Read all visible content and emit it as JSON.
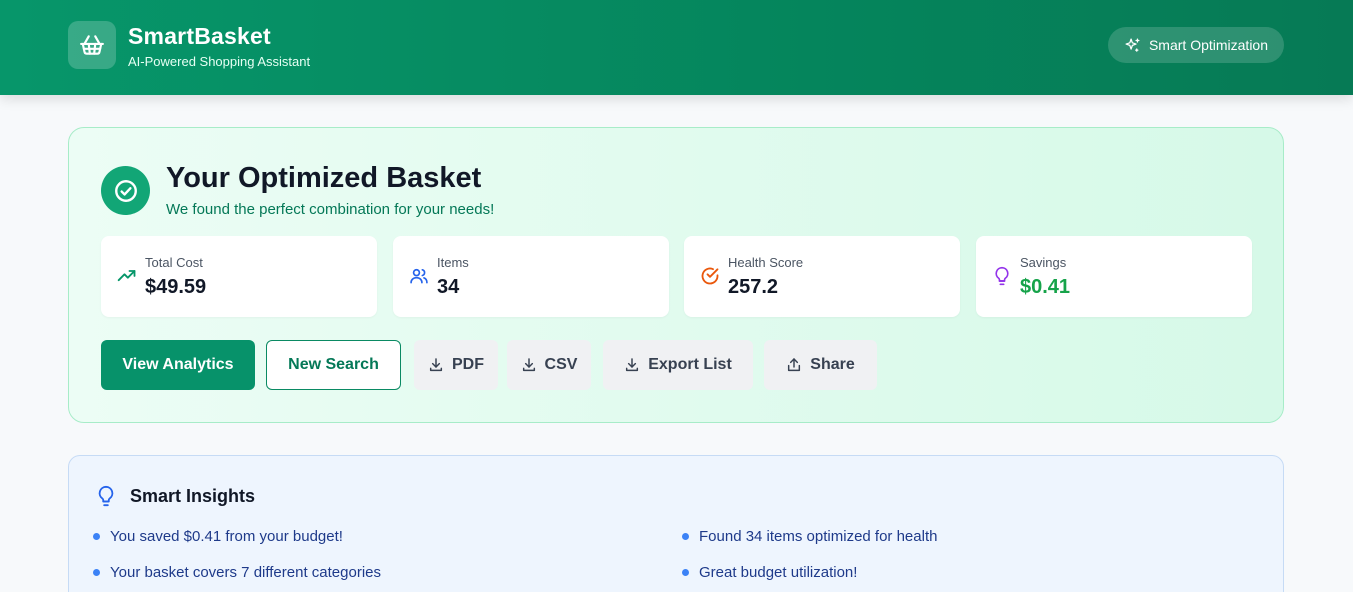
{
  "header": {
    "brand": "SmartBasket",
    "tagline": "AI-Powered Shopping Assistant",
    "optimization_label": "Smart Optimization",
    "logo_icon": "basket-icon",
    "pill_icon": "sparkles-icon"
  },
  "basket": {
    "title": "Your Optimized Basket",
    "subtitle": "We found the perfect combination for your needs!",
    "stats": [
      {
        "label": "Total Cost",
        "value": "$49.59",
        "icon": "trending-up-icon",
        "color": "#059669"
      },
      {
        "label": "Items",
        "value": "34",
        "icon": "users-icon",
        "color": "#2563eb"
      },
      {
        "label": "Health Score",
        "value": "257.2",
        "icon": "check-circle-icon",
        "color": "#ea580c"
      },
      {
        "label": "Savings",
        "value": "$0.41",
        "icon": "lightbulb-icon",
        "color": "#9333ea"
      }
    ],
    "buttons": {
      "view_analytics": "View Analytics",
      "new_search": "New Search",
      "pdf": "PDF",
      "csv": "CSV",
      "export_list": "Export List",
      "share": "Share"
    }
  },
  "insights": {
    "title": "Smart Insights",
    "items": [
      "You saved $0.41 from your budget!",
      "Found 34 items optimized for health",
      "Your basket covers 7 different categories",
      "Great budget utilization!"
    ]
  },
  "colors": {
    "brand_green": "#07926a",
    "accent_blue": "#3b82f6"
  }
}
